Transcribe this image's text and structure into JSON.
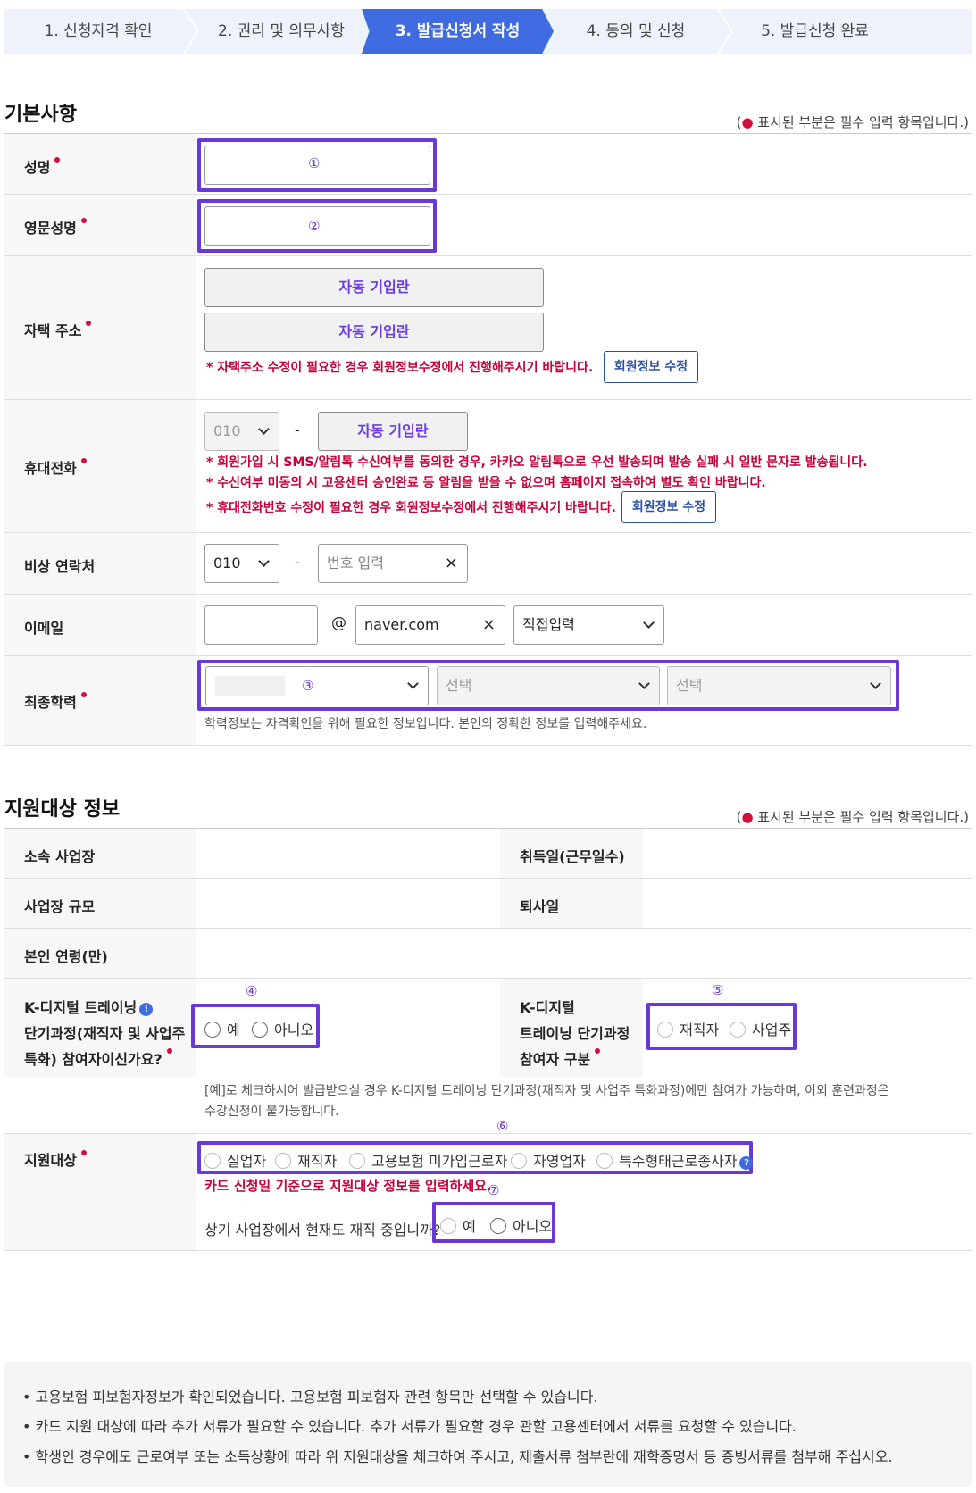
{
  "steps": [
    "1. 신청자격 확인",
    "2. 권리 및 의무사항",
    "3. 발급신청서 작성",
    "4. 동의 및 신청",
    "5. 발급신청 완료"
  ],
  "basic": {
    "title": "기본사항",
    "required_note_pre": "(",
    "required_note_dot": "●",
    "required_note_post": " 표시된 부분은 필수 입력 항목입니다.)",
    "name_label": "성명",
    "name_marker": "①",
    "eng_name_label": "영문성명",
    "eng_name_marker": "②",
    "address_label": "자택 주소",
    "auto_fill": "자동 기입란",
    "address_warn": "* 자택주소 수정이 필요한 경우 회원정보수정에서 진행해주시기 바랍니다.",
    "edit_member_button": "회원정보 수정",
    "mobile_label": "휴대전화",
    "mobile_prefix": "010",
    "dash": "-",
    "mobile_warn1": "* 회원가입 시 SMS/알림톡 수신여부를 동의한 경우, 카카오 알림톡으로 우선 발송되며 발송 실패 시 일반 문자로 발송됩니다.",
    "mobile_warn2": "* 수신여부 미동의 시 고용센터 승인완료 등 알림을 받을 수 없으며 홈페이지 접속하여 별도 확인 바랍니다.",
    "mobile_warn3": "* 휴대전화번호 수정이 필요한 경우 회원정보수정에서 진행해주시기 바랍니다.",
    "emergency_label": "비상 연락처",
    "emergency_prefix": "010",
    "emergency_placeholder": "번호 입력",
    "clear_symbol": "×",
    "email_label": "이메일",
    "at_symbol": "@",
    "email_domain": "naver.com",
    "email_select": "직접입력",
    "education_label": "최종학력",
    "education_marker": "③",
    "education_select2": "선택",
    "education_select3": "선택",
    "education_help": "학력정보는 자격확인을 위해 필요한 정보입니다. 본인의 정확한 정보를 입력해주세요."
  },
  "support": {
    "title": "지원대상 정보",
    "required_note_pre": "(",
    "required_note_dot": "●",
    "required_note_post": " 표시된 부분은 필수 입력 항목입니다.)",
    "workplace_label": "소속 사업장",
    "acquired_label": "취득일(근무일수)",
    "size_label": "사업장 규모",
    "leave_label": "퇴사일",
    "age_label": "본인 연령(만)",
    "kdigital_label_1": "K-디지털 트레이닝",
    "kdigital_info": "!",
    "kdigital_label_2": "단기과정(재직자 및 사업주",
    "kdigital_label_3": "특화) 참여자이신가요?",
    "kdigital_marker": "④",
    "yes": "예",
    "no": "아니오",
    "kdigital_type_label_1": "K-디지털",
    "kdigital_type_label_2": "트레이닝 단기과정",
    "kdigital_type_label_3": "참여자 구분",
    "kdigital_type_marker": "⑤",
    "employee": "재직자",
    "employer": "사업주",
    "kdigital_help_1": "[예]로 체크하시어 발급받으실 경우 K-디지털 트레이닝 단기과정(재직자 및 사업주 특화과정)에만 참여가 가능하며, 이외 훈련과정은",
    "kdigital_help_2": "수강신청이 불가능합니다.",
    "target_label": "지원대상",
    "target_marker": "⑥",
    "target_options": [
      "실업자",
      "재직자",
      "고용보험 미가입근로자",
      "자영업자",
      "특수형태근로종사자"
    ],
    "target_info": "?",
    "target_warn": "카드 신청일 기준으로 지원대상 정보를 입력하세요.",
    "current_marker": "⑦",
    "current_question": "상기 사업장에서 현재도 재직 중입니까?",
    "current_yes": "예",
    "current_no": "아니오"
  },
  "notices": [
    "• 고용보험 피보험자정보가 확인되었습니다. 고용보험 피보험자 관련 항목만 선택할 수 있습니다.",
    "• 카드 지원 대상에 따라 추가 서류가 필요할 수 있습니다. 추가 서류가 필요할 경우 관할 고용센터에서 서류를 요청할 수 있습니다.",
    "• 학생인 경우에도 근로여부 또는 소득상황에 따라 위 지원대상을 체크하여 주시고, 제출서류 첨부란에 재학증명서 등 증빙서류를 첨부해 주십시오."
  ],
  "colors": {
    "accent": "#3e6bdf",
    "highlight": "#6a37d8",
    "warning": "#c9003a",
    "required": "#d0103a"
  }
}
